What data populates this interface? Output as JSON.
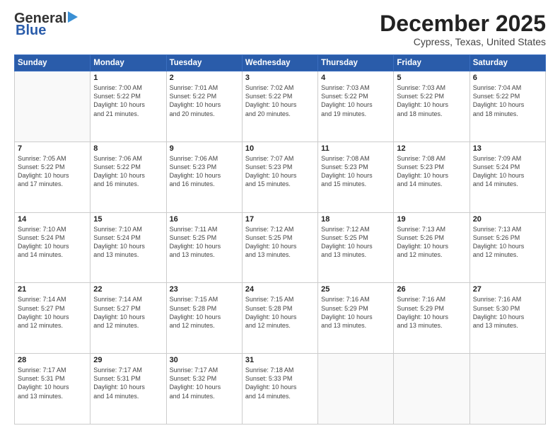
{
  "header": {
    "logo_line1": "General",
    "logo_line2": "Blue",
    "title": "December 2025",
    "subtitle": "Cypress, Texas, United States"
  },
  "calendar": {
    "days_of_week": [
      "Sunday",
      "Monday",
      "Tuesday",
      "Wednesday",
      "Thursday",
      "Friday",
      "Saturday"
    ],
    "weeks": [
      [
        {
          "day": "",
          "info": ""
        },
        {
          "day": "1",
          "info": "Sunrise: 7:00 AM\nSunset: 5:22 PM\nDaylight: 10 hours\nand 21 minutes."
        },
        {
          "day": "2",
          "info": "Sunrise: 7:01 AM\nSunset: 5:22 PM\nDaylight: 10 hours\nand 20 minutes."
        },
        {
          "day": "3",
          "info": "Sunrise: 7:02 AM\nSunset: 5:22 PM\nDaylight: 10 hours\nand 20 minutes."
        },
        {
          "day": "4",
          "info": "Sunrise: 7:03 AM\nSunset: 5:22 PM\nDaylight: 10 hours\nand 19 minutes."
        },
        {
          "day": "5",
          "info": "Sunrise: 7:03 AM\nSunset: 5:22 PM\nDaylight: 10 hours\nand 18 minutes."
        },
        {
          "day": "6",
          "info": "Sunrise: 7:04 AM\nSunset: 5:22 PM\nDaylight: 10 hours\nand 18 minutes."
        }
      ],
      [
        {
          "day": "7",
          "info": "Sunrise: 7:05 AM\nSunset: 5:22 PM\nDaylight: 10 hours\nand 17 minutes."
        },
        {
          "day": "8",
          "info": "Sunrise: 7:06 AM\nSunset: 5:22 PM\nDaylight: 10 hours\nand 16 minutes."
        },
        {
          "day": "9",
          "info": "Sunrise: 7:06 AM\nSunset: 5:23 PM\nDaylight: 10 hours\nand 16 minutes."
        },
        {
          "day": "10",
          "info": "Sunrise: 7:07 AM\nSunset: 5:23 PM\nDaylight: 10 hours\nand 15 minutes."
        },
        {
          "day": "11",
          "info": "Sunrise: 7:08 AM\nSunset: 5:23 PM\nDaylight: 10 hours\nand 15 minutes."
        },
        {
          "day": "12",
          "info": "Sunrise: 7:08 AM\nSunset: 5:23 PM\nDaylight: 10 hours\nand 14 minutes."
        },
        {
          "day": "13",
          "info": "Sunrise: 7:09 AM\nSunset: 5:24 PM\nDaylight: 10 hours\nand 14 minutes."
        }
      ],
      [
        {
          "day": "14",
          "info": "Sunrise: 7:10 AM\nSunset: 5:24 PM\nDaylight: 10 hours\nand 14 minutes."
        },
        {
          "day": "15",
          "info": "Sunrise: 7:10 AM\nSunset: 5:24 PM\nDaylight: 10 hours\nand 13 minutes."
        },
        {
          "day": "16",
          "info": "Sunrise: 7:11 AM\nSunset: 5:25 PM\nDaylight: 10 hours\nand 13 minutes."
        },
        {
          "day": "17",
          "info": "Sunrise: 7:12 AM\nSunset: 5:25 PM\nDaylight: 10 hours\nand 13 minutes."
        },
        {
          "day": "18",
          "info": "Sunrise: 7:12 AM\nSunset: 5:25 PM\nDaylight: 10 hours\nand 13 minutes."
        },
        {
          "day": "19",
          "info": "Sunrise: 7:13 AM\nSunset: 5:26 PM\nDaylight: 10 hours\nand 12 minutes."
        },
        {
          "day": "20",
          "info": "Sunrise: 7:13 AM\nSunset: 5:26 PM\nDaylight: 10 hours\nand 12 minutes."
        }
      ],
      [
        {
          "day": "21",
          "info": "Sunrise: 7:14 AM\nSunset: 5:27 PM\nDaylight: 10 hours\nand 12 minutes."
        },
        {
          "day": "22",
          "info": "Sunrise: 7:14 AM\nSunset: 5:27 PM\nDaylight: 10 hours\nand 12 minutes."
        },
        {
          "day": "23",
          "info": "Sunrise: 7:15 AM\nSunset: 5:28 PM\nDaylight: 10 hours\nand 12 minutes."
        },
        {
          "day": "24",
          "info": "Sunrise: 7:15 AM\nSunset: 5:28 PM\nDaylight: 10 hours\nand 12 minutes."
        },
        {
          "day": "25",
          "info": "Sunrise: 7:16 AM\nSunset: 5:29 PM\nDaylight: 10 hours\nand 13 minutes."
        },
        {
          "day": "26",
          "info": "Sunrise: 7:16 AM\nSunset: 5:29 PM\nDaylight: 10 hours\nand 13 minutes."
        },
        {
          "day": "27",
          "info": "Sunrise: 7:16 AM\nSunset: 5:30 PM\nDaylight: 10 hours\nand 13 minutes."
        }
      ],
      [
        {
          "day": "28",
          "info": "Sunrise: 7:17 AM\nSunset: 5:31 PM\nDaylight: 10 hours\nand 13 minutes."
        },
        {
          "day": "29",
          "info": "Sunrise: 7:17 AM\nSunset: 5:31 PM\nDaylight: 10 hours\nand 14 minutes."
        },
        {
          "day": "30",
          "info": "Sunrise: 7:17 AM\nSunset: 5:32 PM\nDaylight: 10 hours\nand 14 minutes."
        },
        {
          "day": "31",
          "info": "Sunrise: 7:18 AM\nSunset: 5:33 PM\nDaylight: 10 hours\nand 14 minutes."
        },
        {
          "day": "",
          "info": ""
        },
        {
          "day": "",
          "info": ""
        },
        {
          "day": "",
          "info": ""
        }
      ]
    ]
  }
}
